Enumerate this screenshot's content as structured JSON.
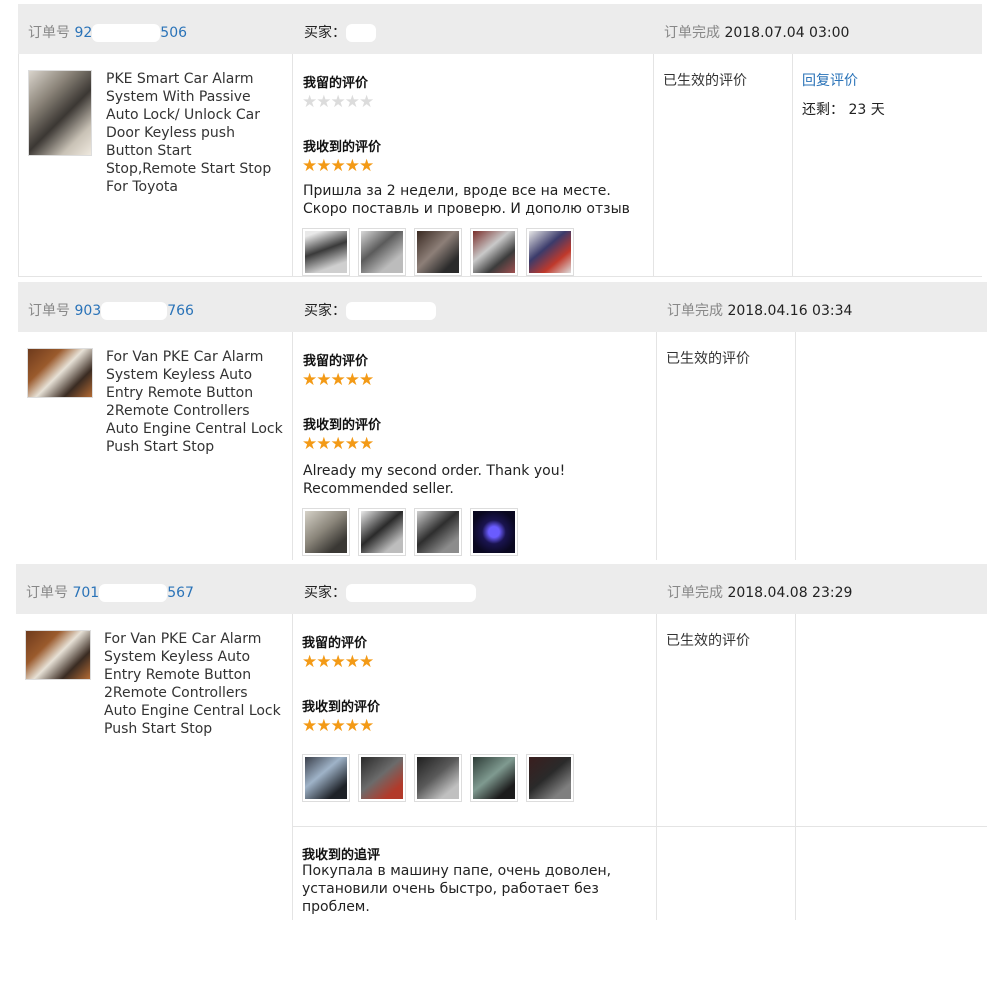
{
  "orders": [
    {
      "order_label": "订单号",
      "order_no_prefix": "92",
      "order_no_suffix": "506",
      "buyer_label": "买家：",
      "completed_label": "订单完成",
      "completed_time": "2018.07.04 03:00",
      "product_title": "PKE Smart Car Alarm System With Passive Auto Lock/ Unlock Car Door Keyless push Button Start Stop,Remote Start Stop For Toyota",
      "my_review_label": "我留的评价",
      "my_review_stars": 0,
      "received_label": "我收到的评价",
      "received_stars": 5,
      "received_text": "Пришла за 2 недели, вроде все на месте. Скоро поставль и проверю. И дополю отзыв",
      "photo_count": 5,
      "status": "已生效的评价",
      "reply_label": "回复评价",
      "remaining_label": "还剩：",
      "remaining_value": "23 天"
    },
    {
      "order_label": "订单号",
      "order_no_prefix": "903",
      "order_no_suffix": "766",
      "buyer_label": "买家：",
      "completed_label": "订单完成",
      "completed_time": "2018.04.16 03:34",
      "product_title": "For Van PKE Car Alarm System Keyless Auto Entry Remote Button 2Remote Controllers Auto Engine Central Lock Push Start Stop",
      "my_review_label": "我留的评价",
      "my_review_stars": 5,
      "received_label": "我收到的评价",
      "received_stars": 5,
      "received_text": "Already my second order. Thank you! Recommended seller.",
      "photo_count": 4,
      "status": "已生效的评价"
    },
    {
      "order_label": "订单号",
      "order_no_prefix": "701",
      "order_no_suffix": "567",
      "buyer_label": "买家：",
      "completed_label": "订单完成",
      "completed_time": "2018.04.08 23:29",
      "product_title": "For Van PKE Car Alarm System Keyless Auto Entry Remote Button 2Remote Controllers Auto Engine Central Lock Push Start Stop",
      "my_review_label": "我留的评价",
      "my_review_stars": 5,
      "received_label": "我收到的评价",
      "received_stars": 5,
      "photo_count": 5,
      "status": "已生效的评价",
      "followup_label": "我收到的追评",
      "followup_text": "Покупала в машину папе, очень доволен, установили очень быстро, работает без проблем."
    }
  ],
  "colors": {
    "header_bg": "#ececec",
    "link": "#2a73b8",
    "star_on": "#f39a16",
    "star_off": "#dcdcdc"
  },
  "icons": {
    "star": "star-icon",
    "product_image": "product-image",
    "review_photo": "review-photo-thumbnail"
  }
}
